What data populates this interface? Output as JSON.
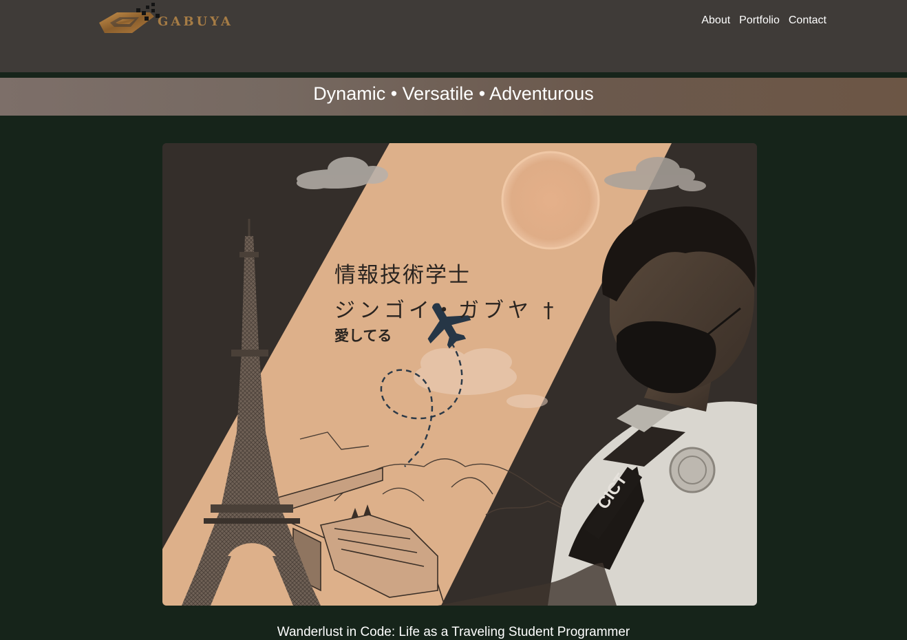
{
  "brand": {
    "name": "GABUYA",
    "accent_color": "#a67c45"
  },
  "nav": {
    "items": [
      "About",
      "Portfolio",
      "Contact"
    ]
  },
  "tagline": "Dynamic • Versatile • Adventurous",
  "hero": {
    "line_1": "情報技術学士",
    "line_2": "ジンゴイ・ガブヤ †",
    "line_3": "愛してる",
    "lanyard_text": "CICT",
    "icons": [
      "eiffel-tower-icon",
      "airplane-icon",
      "sun-icon",
      "cloud-icon",
      "train-icon",
      "mountain-icon"
    ]
  },
  "article": {
    "headline": "Wanderlust in Code: Life as a Traveling Student Programmer"
  },
  "colors": {
    "header_bg": "#3f3b38",
    "page_bg": "#16241a",
    "hero_peach": "#ddb08a",
    "hero_dark": "#342e2a"
  }
}
